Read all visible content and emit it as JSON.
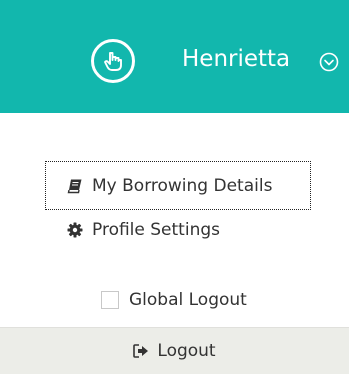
{
  "header": {
    "avatar_icon": "pointing-hand-icon",
    "user_name": "Henrietta",
    "dropdown_icon": "chevron-down-circle-icon",
    "background_color": "#12b7ad"
  },
  "menu": {
    "items": [
      {
        "label": "My Borrowing Details",
        "icon": "book-icon"
      },
      {
        "label": "Profile Settings",
        "icon": "gear-icon"
      }
    ]
  },
  "global_logout": {
    "label": "Global Logout",
    "checked": false
  },
  "logout": {
    "label": "Logout",
    "icon": "sign-out-icon"
  }
}
